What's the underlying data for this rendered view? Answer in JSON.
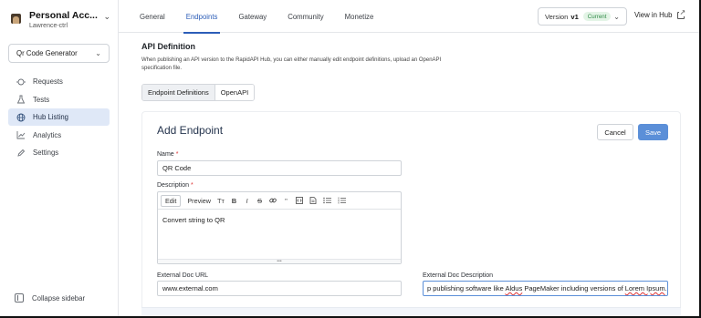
{
  "account": {
    "name": "Personal Acc...",
    "username": "Lawrence-ctrl"
  },
  "project_selector": {
    "value": "Qr Code Generator"
  },
  "sidebar": {
    "items": [
      {
        "label": "Requests",
        "icon": "requests-icon",
        "active": false
      },
      {
        "label": "Tests",
        "icon": "flask-icon",
        "active": false
      },
      {
        "label": "Hub Listing",
        "icon": "globe-icon",
        "active": true
      },
      {
        "label": "Analytics",
        "icon": "chart-line-icon",
        "active": false
      },
      {
        "label": "Settings",
        "icon": "pencil-icon",
        "active": false
      }
    ],
    "collapse_label": "Collapse sidebar"
  },
  "top_tabs": [
    {
      "label": "General",
      "active": false
    },
    {
      "label": "Endpoints",
      "active": true
    },
    {
      "label": "Gateway",
      "active": false
    },
    {
      "label": "Community",
      "active": false
    },
    {
      "label": "Monetize",
      "active": false
    }
  ],
  "version": {
    "label": "Version",
    "value": "v1",
    "badge": "Current"
  },
  "view_in_hub": "View in Hub",
  "api_definition": {
    "title": "API Definition",
    "description": "When publishing an API version to the RapidAPI Hub, you can either manually edit endpoint definitions, upload an OpenAPI specification file.",
    "toggle": {
      "options": [
        "Endpoint Definitions",
        "OpenAPI"
      ],
      "selected": "Endpoint Definitions"
    }
  },
  "add_endpoint": {
    "title": "Add Endpoint",
    "cancel_label": "Cancel",
    "save_label": "Save",
    "name_label": "Name",
    "name_value": "QR Code",
    "description_label": "Description",
    "editor_toolbar": {
      "edit": "Edit",
      "preview": "Preview",
      "buttons": [
        "Tт",
        "B",
        "I",
        "S",
        "🔗",
        "\"",
        "⊡",
        "▤",
        "≔",
        "⁝≡"
      ]
    },
    "description_value": "Convert string to QR",
    "required_mark": "*",
    "external_doc_url_label": "External Doc URL",
    "external_doc_url_value": "www.external.com",
    "external_doc_desc_label": "External Doc Description",
    "external_doc_desc_prefix": "p publishing software like ",
    "external_doc_desc_word1": "Aldus",
    "external_doc_desc_middle": " PageMaker including versions of ",
    "external_doc_desc_word2": "Lorem Ipsum",
    "external_doc_desc_suffix": "."
  },
  "colors": {
    "accent": "#2c5db8",
    "save_button": "#5b8fd8",
    "active_nav_bg": "#dfe8f7",
    "badge_green": "#2f8a46"
  }
}
